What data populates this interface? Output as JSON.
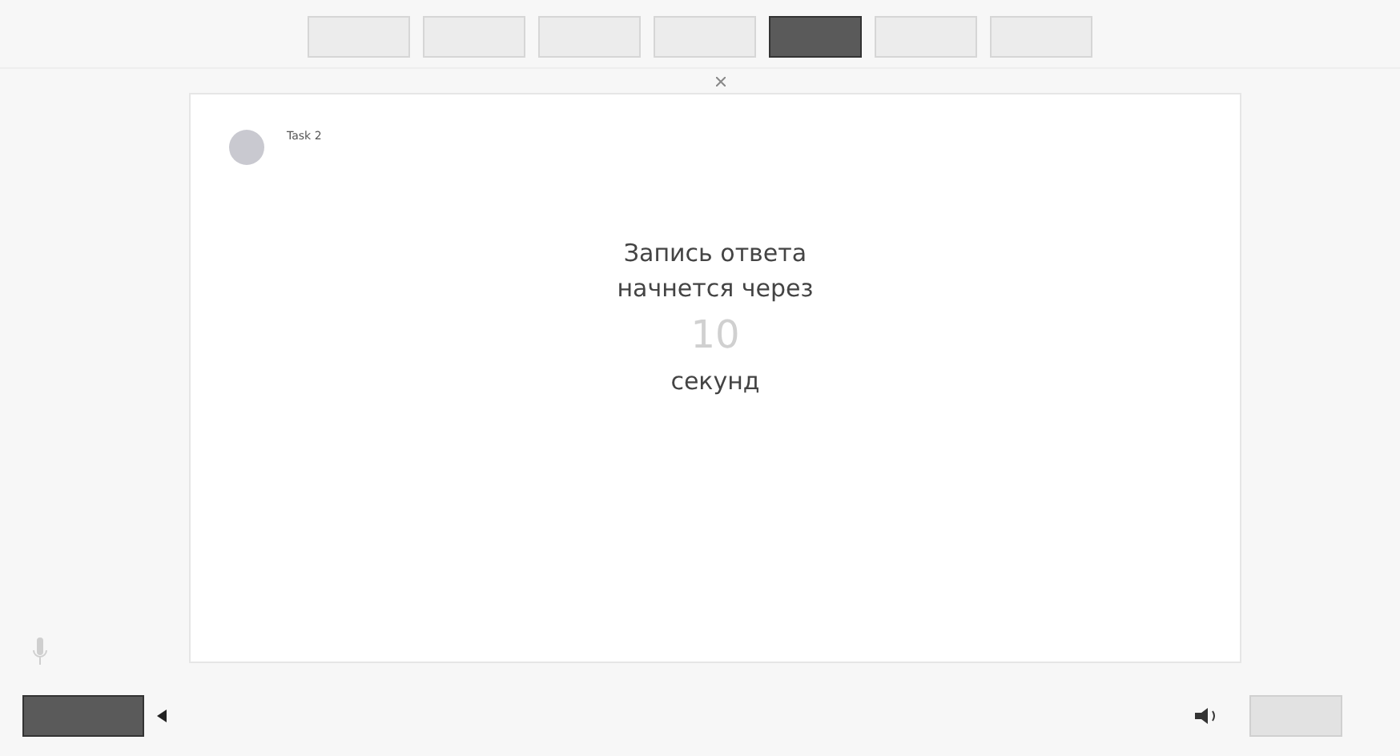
{
  "tabs": [
    {
      "selected": false
    },
    {
      "selected": false
    },
    {
      "selected": false
    },
    {
      "selected": false
    },
    {
      "selected": true
    },
    {
      "selected": false
    },
    {
      "selected": false
    }
  ],
  "task": {
    "label": "Task 2"
  },
  "countdown": {
    "line_1": "Запись ответа",
    "line_2": "начнется через",
    "number": "10",
    "unit": "секунд"
  }
}
